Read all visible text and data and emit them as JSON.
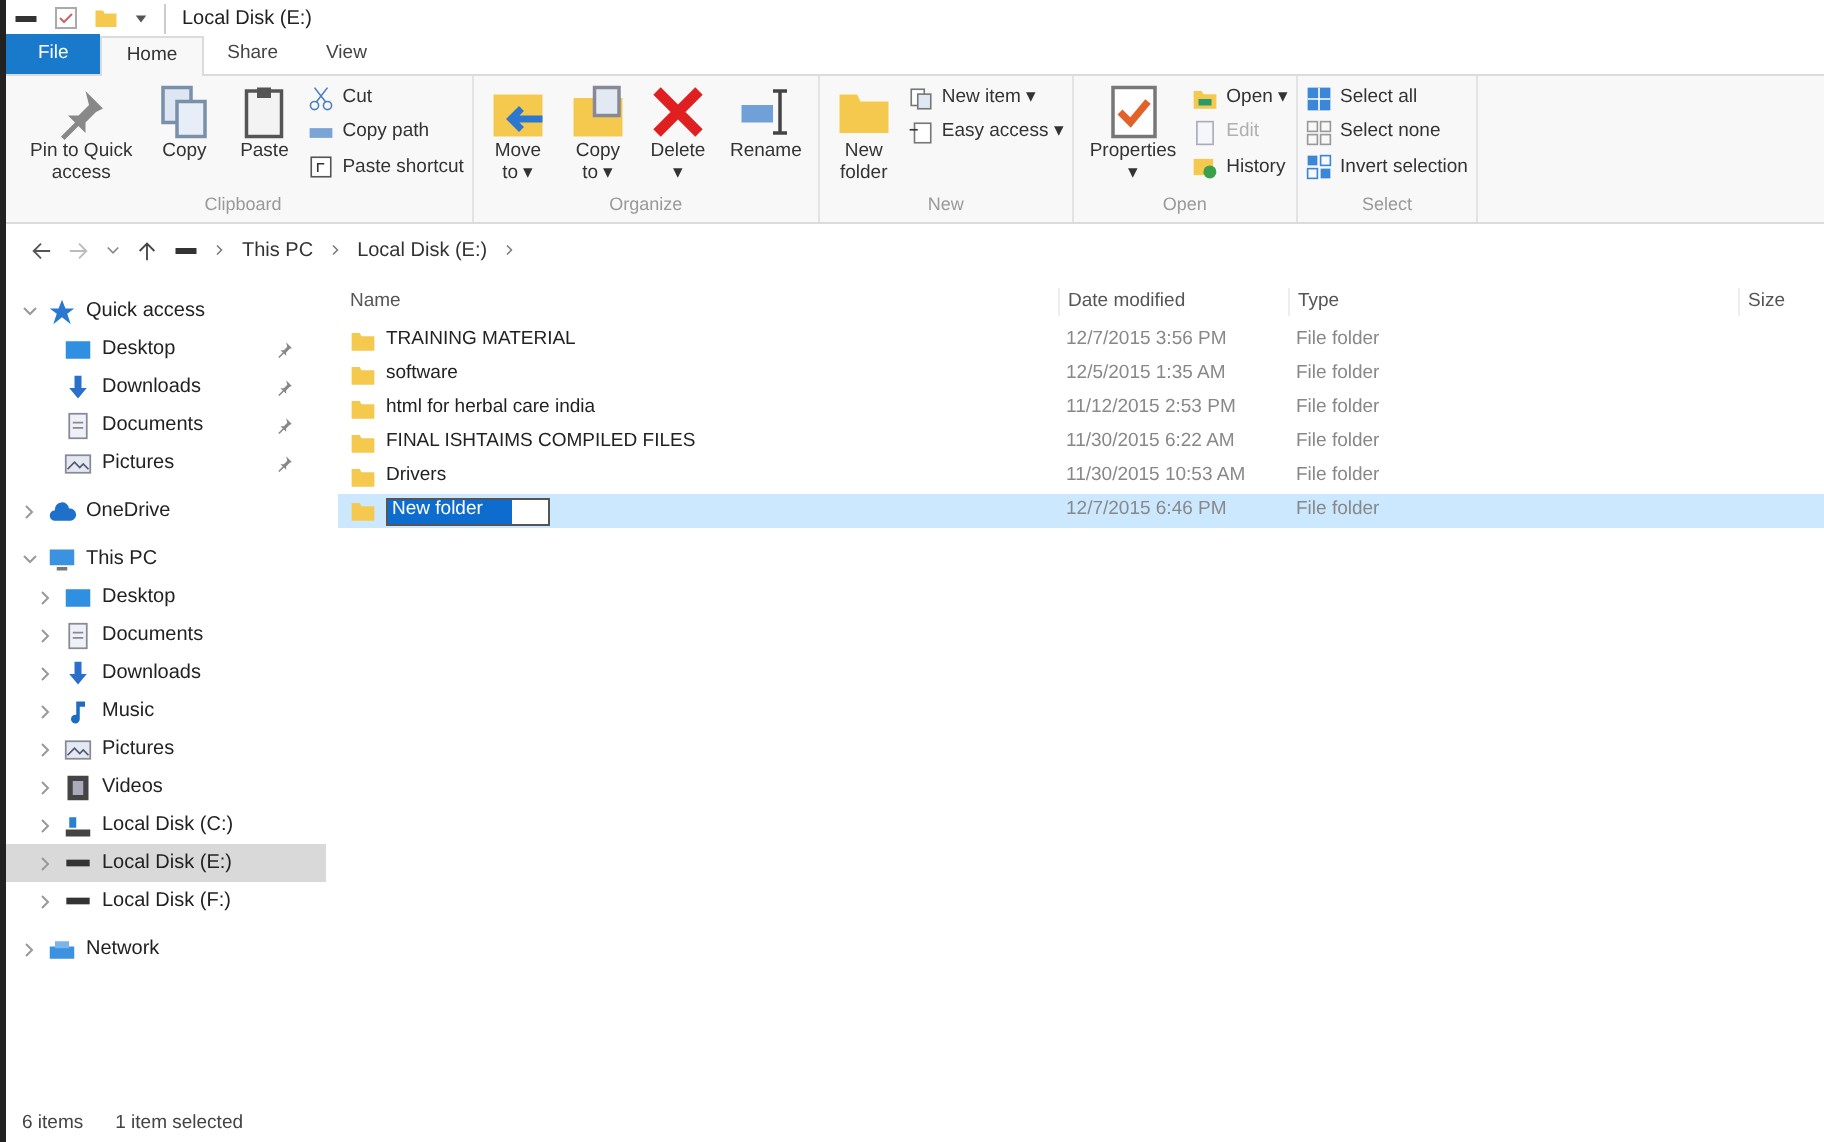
{
  "window": {
    "title": "Local Disk (E:)"
  },
  "tabs": [
    {
      "label": "File",
      "kind": "file",
      "selected": false
    },
    {
      "label": "Home",
      "kind": "tab",
      "selected": true
    },
    {
      "label": "Share",
      "kind": "tab",
      "selected": false
    },
    {
      "label": "View",
      "kind": "tab",
      "selected": false
    }
  ],
  "ribbon": [
    {
      "label": "Clipboard",
      "items": [
        {
          "kind": "large",
          "lines": [
            "Pin to Quick",
            "access"
          ]
        },
        {
          "kind": "large",
          "lines": [
            "Copy"
          ]
        },
        {
          "kind": "large",
          "lines": [
            "Paste"
          ]
        },
        {
          "kind": "stack",
          "entries": [
            {
              "label": "Cut",
              "disabled": false
            },
            {
              "label": "Copy path",
              "disabled": false
            },
            {
              "label": "Paste shortcut",
              "disabled": false
            }
          ]
        }
      ]
    },
    {
      "label": "Organize",
      "items": [
        {
          "kind": "large",
          "lines": [
            "Move",
            "to ▾"
          ]
        },
        {
          "kind": "large",
          "lines": [
            "Copy",
            "to ▾"
          ]
        },
        {
          "kind": "large",
          "lines": [
            "Delete",
            "▾"
          ]
        },
        {
          "kind": "large",
          "lines": [
            "Rename"
          ]
        }
      ]
    },
    {
      "label": "New",
      "items": [
        {
          "kind": "large",
          "lines": [
            "New",
            "folder"
          ]
        },
        {
          "kind": "stack",
          "entries": [
            {
              "label": "New item ▾",
              "disabled": false
            },
            {
              "label": "Easy access ▾",
              "disabled": false
            }
          ]
        }
      ]
    },
    {
      "label": "Open",
      "items": [
        {
          "kind": "large",
          "lines": [
            "Properties",
            "▾"
          ]
        },
        {
          "kind": "stack",
          "entries": [
            {
              "label": "Open ▾",
              "disabled": false
            },
            {
              "label": "Edit",
              "disabled": true
            },
            {
              "label": "History",
              "disabled": false
            }
          ]
        }
      ]
    },
    {
      "label": "Select",
      "items": [
        {
          "kind": "stack",
          "entries": [
            {
              "label": "Select all",
              "disabled": false
            },
            {
              "label": "Select none",
              "disabled": false
            },
            {
              "label": "Invert selection",
              "disabled": false
            }
          ]
        }
      ]
    }
  ],
  "address": {
    "path": [
      "This PC",
      "Local Disk (E:)"
    ]
  },
  "sidebar": [
    {
      "label": "Quick access",
      "expanded": true,
      "selected": false,
      "children": [
        {
          "label": "Desktop",
          "pinned": true,
          "selected": false
        },
        {
          "label": "Downloads",
          "pinned": true,
          "selected": false
        },
        {
          "label": "Documents",
          "pinned": true,
          "selected": false
        },
        {
          "label": "Pictures",
          "pinned": true,
          "selected": false
        }
      ]
    },
    {
      "label": "OneDrive",
      "expanded": false,
      "selected": false
    },
    {
      "label": "This PC",
      "expanded": true,
      "selected": false,
      "children": [
        {
          "label": "Desktop",
          "expanded": false,
          "selected": false
        },
        {
          "label": "Documents",
          "expanded": false,
          "selected": false
        },
        {
          "label": "Downloads",
          "expanded": false,
          "selected": false
        },
        {
          "label": "Music",
          "expanded": false,
          "selected": false
        },
        {
          "label": "Pictures",
          "expanded": false,
          "selected": false
        },
        {
          "label": "Videos",
          "expanded": false,
          "selected": false
        },
        {
          "label": "Local Disk (C:)",
          "expanded": false,
          "selected": false
        },
        {
          "label": "Local Disk (E:)",
          "expanded": false,
          "selected": true
        },
        {
          "label": "Local Disk (F:)",
          "expanded": false,
          "selected": false
        }
      ]
    },
    {
      "label": "Network",
      "expanded": false,
      "selected": false
    }
  ],
  "table": {
    "columns": [
      "Name",
      "Date modified",
      "Type",
      "Size"
    ],
    "rows": [
      {
        "name": "TRAINING MATERIAL",
        "date": "12/7/2015 3:56 PM",
        "type": "File folder",
        "selected": false,
        "editing": false
      },
      {
        "name": "software",
        "date": "12/5/2015 1:35 AM",
        "type": "File folder",
        "selected": false,
        "editing": false
      },
      {
        "name": "html for herbal care india",
        "date": "11/12/2015 2:53 PM",
        "type": "File folder",
        "selected": false,
        "editing": false
      },
      {
        "name": "FINAL ISHTAIMS COMPILED FILES",
        "date": "11/30/2015 6:22 AM",
        "type": "File folder",
        "selected": false,
        "editing": false
      },
      {
        "name": "Drivers",
        "date": "11/30/2015 10:53 AM",
        "type": "File folder",
        "selected": false,
        "editing": false
      },
      {
        "name": "New folder",
        "date": "12/7/2015 6:46 PM",
        "type": "File folder",
        "selected": true,
        "editing": true
      }
    ]
  },
  "status_bar": {
    "count": "6 items",
    "selection": "1 item selected"
  }
}
